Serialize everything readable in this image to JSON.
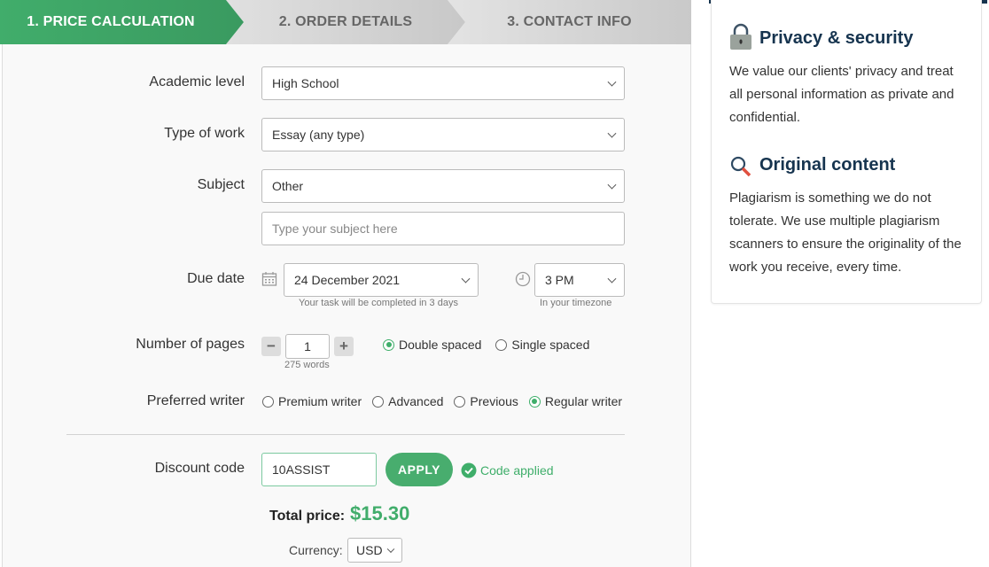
{
  "steps": [
    {
      "label": "1. PRICE CALCULATION",
      "active": true
    },
    {
      "label": "2. ORDER DETAILS",
      "active": false
    },
    {
      "label": "3. CONTACT INFO",
      "active": false
    }
  ],
  "form": {
    "academic_level": {
      "label": "Academic level",
      "value": "High School"
    },
    "type_of_work": {
      "label": "Type of work",
      "value": "Essay (any type)"
    },
    "subject": {
      "label": "Subject",
      "value": "Other",
      "custom_placeholder": "Type your subject here"
    },
    "due_date": {
      "label": "Due date",
      "date": "24 December 2021",
      "date_hint": "Your task will be completed in 3 days",
      "time": "3 PM",
      "time_hint": "In your timezone"
    },
    "pages": {
      "label": "Number of pages",
      "value": "1",
      "words": "275 words",
      "minus": "−",
      "plus": "+",
      "spacing": [
        {
          "label": "Double spaced",
          "selected": true
        },
        {
          "label": "Single spaced",
          "selected": false
        }
      ]
    },
    "writer": {
      "label": "Preferred writer",
      "options": [
        {
          "label": "Premium writer",
          "selected": false
        },
        {
          "label": "Advanced",
          "selected": false
        },
        {
          "label": "Previous",
          "selected": false
        },
        {
          "label": "Regular writer",
          "selected": true
        }
      ]
    },
    "discount": {
      "label": "Discount code",
      "value": "10ASSIST",
      "apply": "APPLY",
      "status": "Code applied"
    },
    "total": {
      "label": "Total price:",
      "value": "$15.30"
    },
    "currency": {
      "label": "Currency:",
      "value": "USD"
    }
  },
  "sidebar": {
    "privacy": {
      "title": "Privacy & security",
      "text": "We value our clients' privacy and treat all personal information as private and confidential."
    },
    "original": {
      "title": "Original content",
      "text": "Plagiarism is something we do not tolerate. We use multiple plagiarism scanners to ensure the originality of the work you receive, every time."
    }
  },
  "colors": {
    "accent": "#41ad6b",
    "navy": "#16344f"
  }
}
